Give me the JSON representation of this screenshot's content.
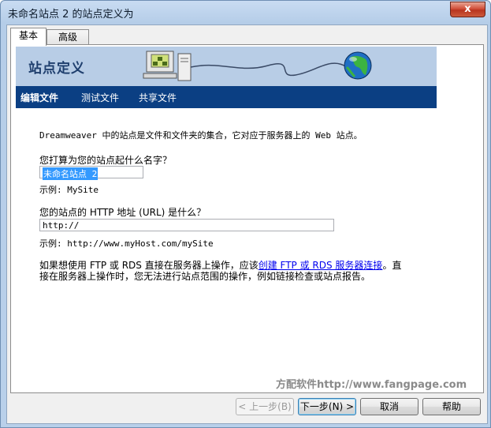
{
  "window": {
    "title": "未命名站点 2 的站点定义为",
    "close_label": "x"
  },
  "tabs": [
    {
      "label": "基本",
      "active": true
    },
    {
      "label": "高级",
      "active": false
    }
  ],
  "banner": {
    "title": "站点定义"
  },
  "nav": [
    {
      "label": "编辑文件",
      "selected": true
    },
    {
      "label": "测试文件",
      "selected": false
    },
    {
      "label": "共享文件",
      "selected": false
    }
  ],
  "content": {
    "intro": "Dreamweaver 中的站点是文件和文件夹的集合，它对应于服务器上的 Web 站点。",
    "name_question": "您打算为您的站点起什么名字？",
    "name_value": "未命名站点 2",
    "name_example": "示例: MySite",
    "url_question": "您的站点的 HTTP 地址 (URL) 是什么？",
    "url_value": "http://",
    "url_example": "示例: http://www.myHost.com/mySite",
    "ftp_note_1": "如果想使用 FTP 或 RDS 直接在服务器上操作，应该",
    "ftp_link": "创建 FTP 或 RDS 服务器连接",
    "ftp_note_2": "。直",
    "ftp_note_3": "接在服务器上操作时，您无法进行站点范围的操作，例如链接检查或站点报告。"
  },
  "watermark": "方配软件http://www.fangpage.com",
  "buttons": {
    "back": "< 上一步(B)",
    "next": "下一步(N) >",
    "cancel": "取消",
    "help": "帮助"
  },
  "colors": {
    "banner_bg": "#b8cde6",
    "nav_bg": "#0b3f83",
    "link": "#0000ee",
    "selection": "#3399ff"
  }
}
